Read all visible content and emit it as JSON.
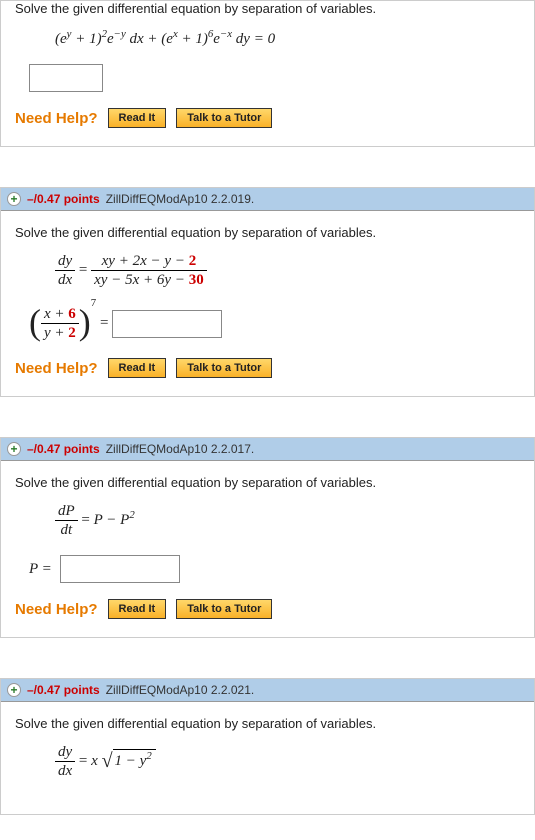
{
  "q1": {
    "prompt": "Solve the given differential equation by separation of variables.",
    "equation_html": "(<i>e</i><sup>y</sup> + 1)<sup>2</sup><i>e</i><sup>−y</sup> <i>dx</i> + (<i>e</i><sup>x</sup> + 1)<sup>6</sup><i>e</i><sup>−x</sup> <i>dy</i> = 0"
  },
  "q2": {
    "points": "–/0.47 points",
    "ref": "ZillDiffEQModAp10 2.2.019.",
    "prompt": "Solve the given differential equation by separation of variables.",
    "frac1_num": "dy",
    "frac1_den": "dx",
    "rhs_num_html": "<i>xy</i> + 2<i>x</i> − <i>y</i> − <span class='red'>2</span>",
    "rhs_den_html": "<i>xy</i> − 5<i>x</i> + 6<i>y</i> − <span class='red'>30</span>",
    "lhs2_num_html": "<i>x</i> + <span class='red'>6</span>",
    "lhs2_den_html": "<i>y</i> + <span class='red'>2</span>",
    "exp": "7"
  },
  "q3": {
    "points": "–/0.47 points",
    "ref": "ZillDiffEQModAp10 2.2.017.",
    "prompt": "Solve the given differential equation by separation of variables.",
    "eq_num": "dP",
    "eq_den": "dt",
    "eq_rhs_html": "<i>P</i> − <i>P</i><sup>2</sup>",
    "answer_label": "P ="
  },
  "q4": {
    "points": "–/0.47 points",
    "ref": "ZillDiffEQModAp10 2.2.021.",
    "prompt": "Solve the given differential equation by separation of variables.",
    "frac_num": "dy",
    "frac_den": "dx",
    "rhs_pre": "x",
    "sqrt_body_html": "1 − <i>y</i><sup>2</sup>"
  },
  "help": {
    "label": "Need Help?",
    "read": "Read It",
    "tutor": "Talk to a Tutor"
  }
}
